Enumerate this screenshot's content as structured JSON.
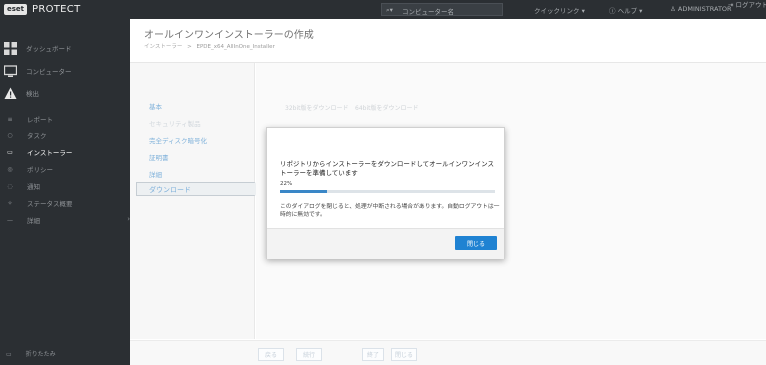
{
  "header": {
    "logo_badge": "eset",
    "app_name": "PROTECT",
    "search_label": "コンピューター名",
    "quick_links": "クイックリンク",
    "help": "ヘルプ",
    "user": "ADMINISTRATOR",
    "logout": "ログアウト"
  },
  "sidebar": {
    "dashboard": "ダッシュボード",
    "computers": "コンピューター",
    "detections": "検出",
    "items": [
      {
        "label": "レポート",
        "icon": "report-icon"
      },
      {
        "label": "タスク",
        "icon": "task-icon"
      },
      {
        "label": "インストーラー",
        "icon": "installer-icon",
        "active": true
      },
      {
        "label": "ポリシー",
        "icon": "policy-icon"
      },
      {
        "label": "通知",
        "icon": "notification-icon"
      },
      {
        "label": "ステータス概要",
        "icon": "status-icon"
      },
      {
        "label": "詳細",
        "icon": "more-icon"
      }
    ],
    "collapse": "折りたたみ"
  },
  "page": {
    "title": "オールインワンインストーラーの作成",
    "breadcrumb_root": "インストーラー",
    "breadcrumb_sep": ">",
    "breadcrumb_current": "EPDE_x64_AllInOne_Installer"
  },
  "steps": [
    {
      "label": "基本"
    },
    {
      "label": "セキュリティ製品"
    },
    {
      "label": "完全ディスク暗号化"
    },
    {
      "label": "証明書"
    },
    {
      "label": "詳細"
    }
  ],
  "active_step": "ダウンロード",
  "content": {
    "download_32": "32bit版をダウンロード",
    "download_64": "64bit版をダウンロード"
  },
  "footer": {
    "back": "戻る",
    "continue": "続行",
    "finish": "終了",
    "close": "閉じる"
  },
  "modal": {
    "message": "リポジトリからインストーラーをダウンロードしてオールインワンインストーラーを準備しています",
    "progress_label": "22%",
    "progress_value": 0.22,
    "note": "このダイアログを閉じると、処理が中断される場合があります。自動ログアウトは一時的に無効です。",
    "close": "閉じる"
  },
  "colors": {
    "topbar": "#2b2f33",
    "accent": "#3a87c7",
    "primary_button": "#1f82d2"
  }
}
